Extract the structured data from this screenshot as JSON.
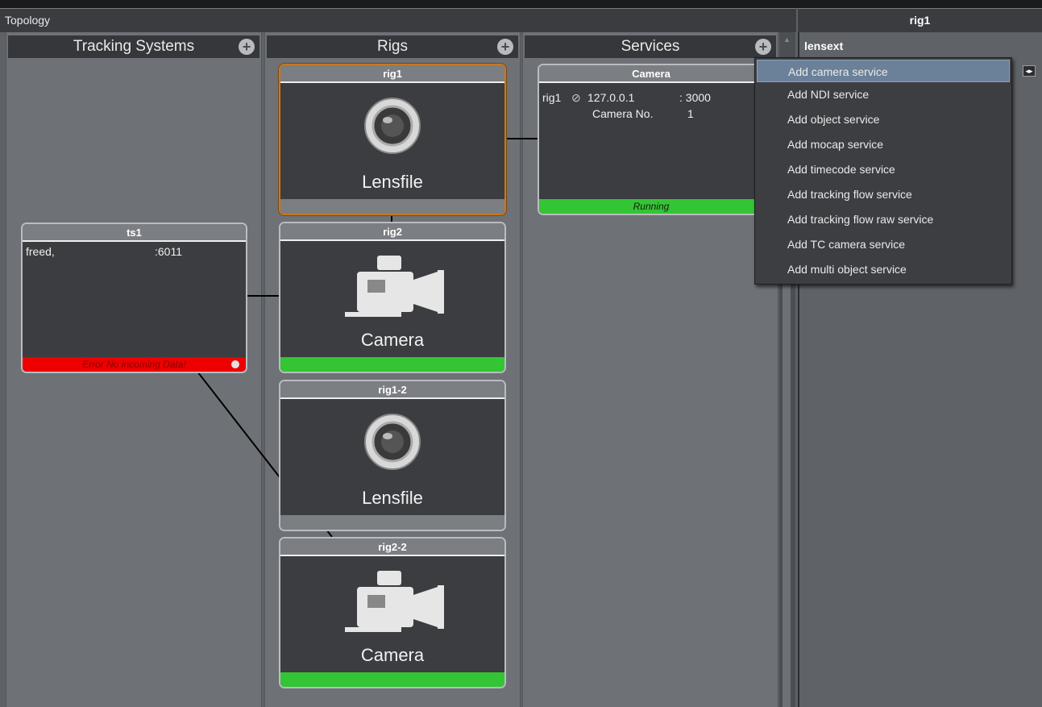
{
  "panel": {
    "title": "Topology"
  },
  "right": {
    "title": "rig1",
    "section": "lensext"
  },
  "columns": {
    "tracking": {
      "title": "Tracking Systems"
    },
    "rigs": {
      "title": "Rigs"
    },
    "services": {
      "title": "Services"
    }
  },
  "ts1": {
    "title": "ts1",
    "protocol": "freed,",
    "port": ":6011",
    "status": "Error No incoming Data!"
  },
  "rigs": [
    {
      "title": "rig1",
      "label": "Lensfile",
      "kind": "lens"
    },
    {
      "title": "rig2",
      "label": "Camera",
      "kind": "camera"
    },
    {
      "title": "rig1-2",
      "label": "Lensfile",
      "kind": "lens"
    },
    {
      "title": "rig2-2",
      "label": "Camera",
      "kind": "camera"
    }
  ],
  "service": {
    "title": "Camera",
    "rig": "rig1",
    "ip": "127.0.0.1",
    "port": ": 3000",
    "cam_label": "Camera No.",
    "cam_no": "1",
    "status": "Running"
  },
  "menu": {
    "items": [
      "Add camera service",
      "Add NDI service",
      "Add object service",
      "Add mocap service",
      "Add timecode service",
      "Add tracking flow service",
      "Add tracking flow raw service",
      "Add TC camera service",
      "Add multi object service"
    ],
    "highlighted_index": 0
  },
  "colors": {
    "status_ok": "#33c533",
    "status_error": "#ee0000",
    "selection": "#c7791f",
    "menu_highlight": "#6b8099"
  },
  "icons": {
    "plus": "plus-circle-icon",
    "lens": "lens-icon",
    "camera": "camera-icon",
    "link": "link-broken-icon",
    "menu": "menu-icon",
    "expand": "expand-icon"
  }
}
